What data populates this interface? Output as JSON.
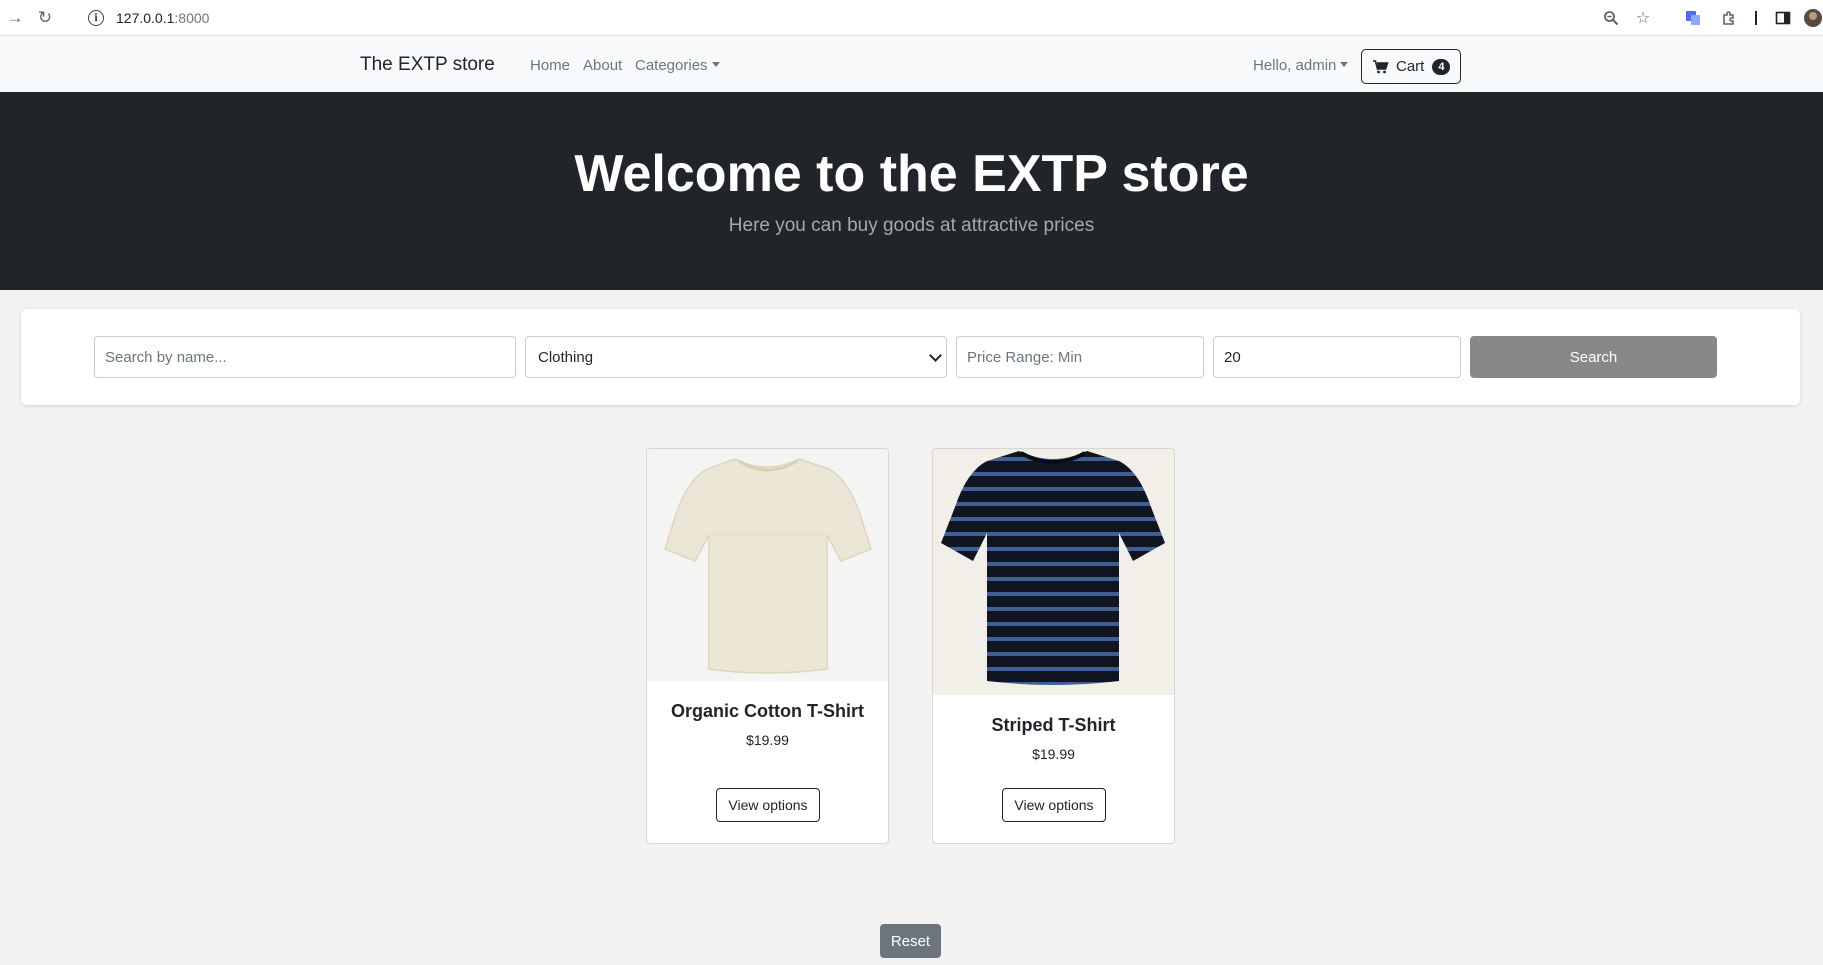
{
  "browser": {
    "url_host": "127.0.0.1",
    "url_port": ":8000"
  },
  "navbar": {
    "brand": "The EXTP store",
    "links": {
      "home": "Home",
      "about": "About",
      "categories": "Categories"
    },
    "user_menu": "Hello, admin",
    "cart_label": "Cart",
    "cart_count": "4"
  },
  "hero": {
    "title": "Welcome to the EXTP store",
    "subtitle": "Here you can buy goods at attractive prices"
  },
  "search": {
    "name_placeholder": "Search by name...",
    "category_selected": "Clothing",
    "price_min_placeholder": "Price Range: Min",
    "price_max_value": "20",
    "button_label": "Search"
  },
  "products": [
    {
      "name": "Organic Cotton T-Shirt",
      "price": "$19.99",
      "button": "View options"
    },
    {
      "name": "Striped T-Shirt",
      "price": "$19.99",
      "button": "View options"
    }
  ],
  "reset_label": "Reset",
  "colors": {
    "hero_bg": "#212529",
    "search_button": "#888888",
    "reset_button": "#6c757d"
  }
}
